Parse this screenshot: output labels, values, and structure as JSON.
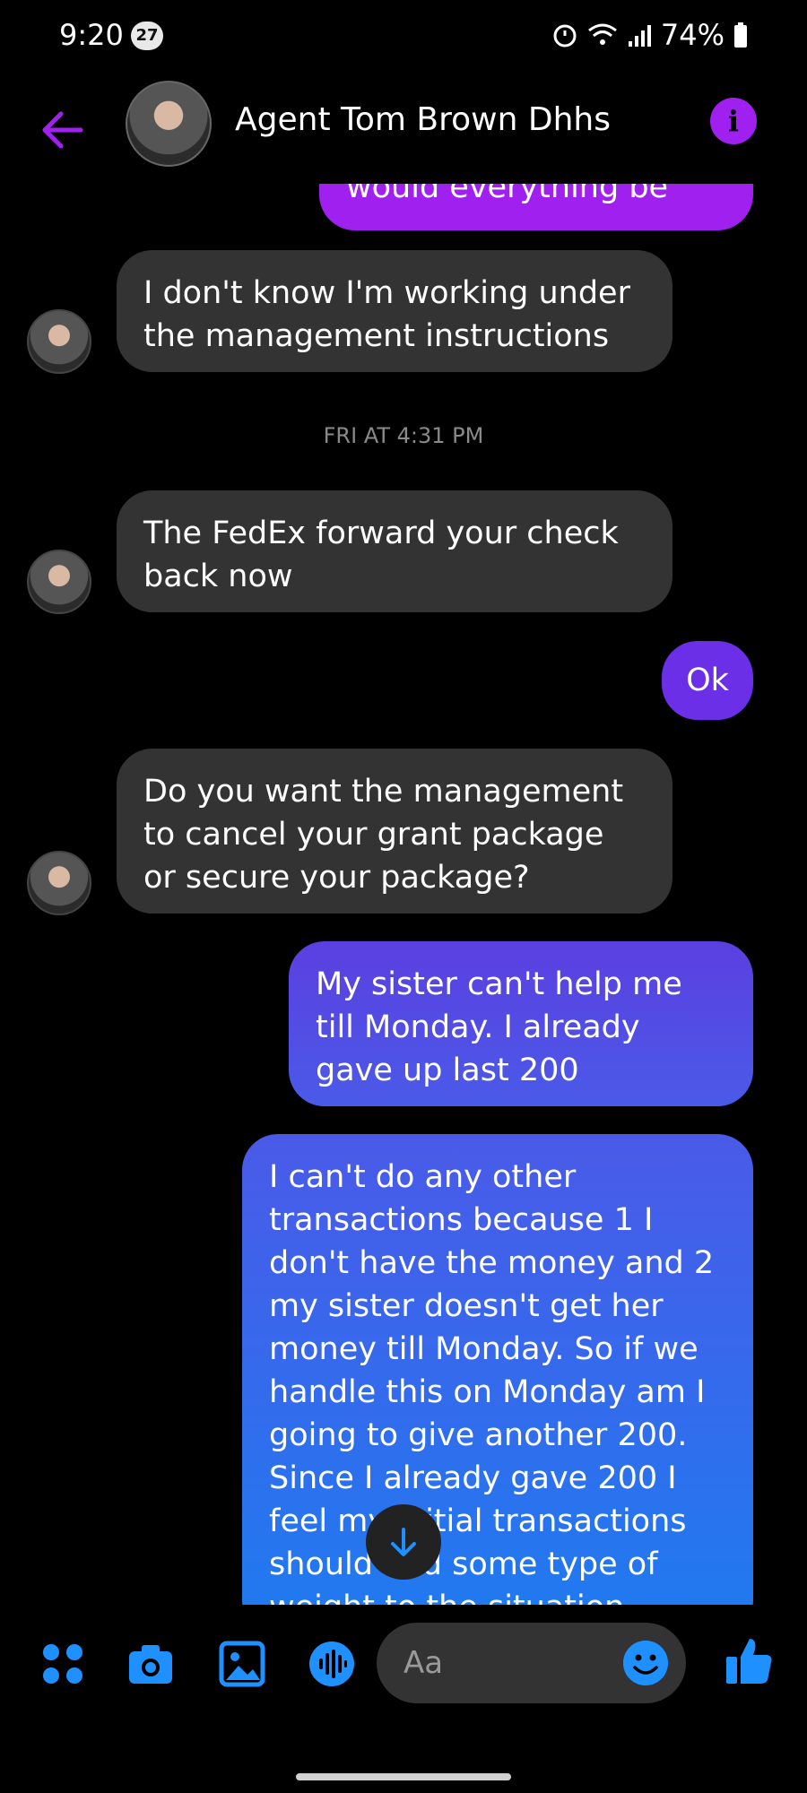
{
  "status_bar": {
    "time": "9:20",
    "notification_count": "27",
    "battery": "74%"
  },
  "header": {
    "contact_name": "Agent Tom Brown Dhhs",
    "info_glyph": "i"
  },
  "messages": [
    {
      "side": "out",
      "text": "would everything be"
    },
    {
      "side": "in",
      "text": "I don't know I'm working under the management instructions"
    },
    {
      "side": "in",
      "text": "The FedEx forward your check back now"
    },
    {
      "side": "out",
      "text": "Ok"
    },
    {
      "side": "in",
      "text": "Do you want the management to cancel your grant package or secure your package?"
    },
    {
      "side": "out",
      "text": "My sister can't help me till Monday. I already gave up last 200"
    },
    {
      "side": "out",
      "text": "I can't do any other transactions because 1 I don't have the money  and 2 my sister doesn't get her money till Monday. So if we handle this on Monday am I going to give another 200. Since I already gave 200 I feel my initial transactions should add some type of weight to the situation"
    }
  ],
  "timestamp": "FRI AT 4:31 PM",
  "composer": {
    "placeholder": "Aa"
  },
  "icons": [
    "back-arrow-icon",
    "info-icon",
    "menu-dots-icon",
    "camera-icon",
    "gallery-icon",
    "microphone-icon",
    "emoji-icon",
    "thumbs-up-icon",
    "scroll-down-icon"
  ],
  "colors": {
    "accent": "#a020f0",
    "incoming": "#333333",
    "outgoing_top": "#5b3fe0",
    "outgoing_bottom": "#1e7bf0",
    "composer_icon": "#1e90ff"
  }
}
